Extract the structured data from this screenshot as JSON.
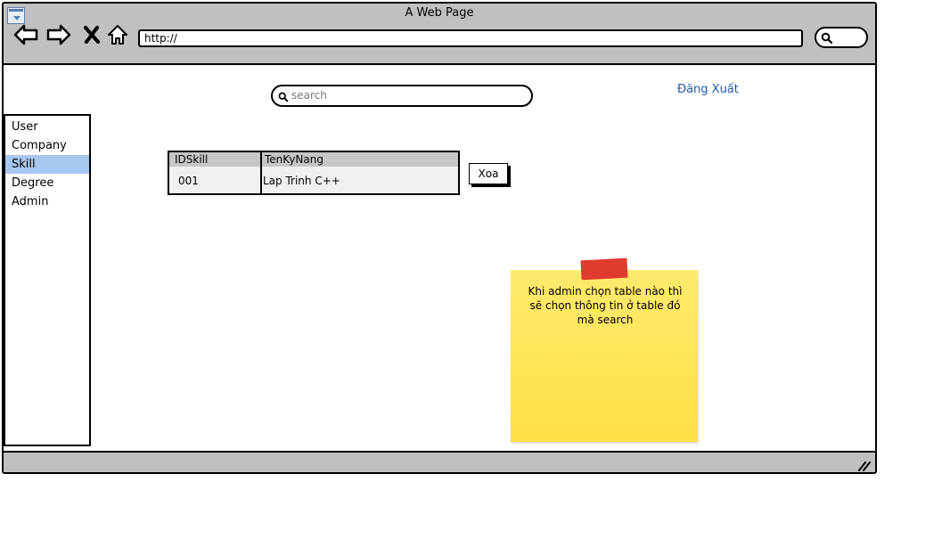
{
  "browser": {
    "title": "A Web Page",
    "url": "http://"
  },
  "header": {
    "search_placeholder": "search",
    "logout_label": "Đăng Xuất"
  },
  "sidebar": {
    "items": [
      {
        "label": "User",
        "selected": false
      },
      {
        "label": "Company",
        "selected": false
      },
      {
        "label": "Skill",
        "selected": true
      },
      {
        "label": "Degree",
        "selected": false
      },
      {
        "label": "Admin",
        "selected": false
      }
    ]
  },
  "table": {
    "columns": [
      "IDSkill",
      "TenKyNang"
    ],
    "rows": [
      [
        "001",
        "Lap Trinh C++"
      ]
    ]
  },
  "actions": {
    "delete_label": "Xoa"
  },
  "sticky_note": {
    "text": "Khi admin chọn table nào thì sẽ chọn thông tin ở table đó mà search"
  },
  "colors": {
    "selected_item": "#a8c7f0",
    "link": "#1f5aa6",
    "sticky": "#ffe454",
    "tape": "#e03b2f",
    "chrome": "#c0c0c0"
  }
}
